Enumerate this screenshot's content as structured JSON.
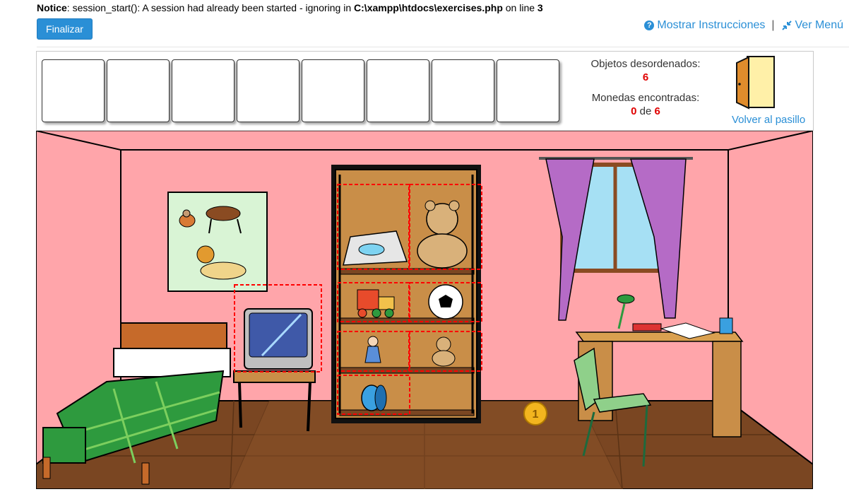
{
  "notice": {
    "label": "Notice",
    "message": ": session_start(): A session had already been started - ignoring in ",
    "file": "C:\\xampp\\htdocs\\exercises.php",
    "on_line": " on line ",
    "line": "3"
  },
  "toolbar": {
    "finalizar_label": "Finalizar"
  },
  "links": {
    "instrucciones_label": "Mostrar Instrucciones",
    "separator": "|",
    "menu_label": "Ver Menú"
  },
  "inventory": {
    "slot_count": 8
  },
  "stats": {
    "desordenados_label": "Objetos desordenados:",
    "desordenados_value": "6",
    "monedas_label": "Monedas encontradas:",
    "monedas_found": "0",
    "monedas_of": "de",
    "monedas_total": "6"
  },
  "exit": {
    "label": "Volver al pasillo"
  },
  "scene": {
    "coin_label": "1",
    "items": [
      "iron",
      "teddy-bear",
      "toy-train",
      "soccer-ball",
      "doll",
      "small-teddy",
      "yoyo",
      "tv"
    ]
  },
  "colors": {
    "accent": "#2a8fd6",
    "wall": "#ffa5aa",
    "floor": "#7a4622",
    "shelf": "#c98e48",
    "highlight": "#ff0000"
  }
}
